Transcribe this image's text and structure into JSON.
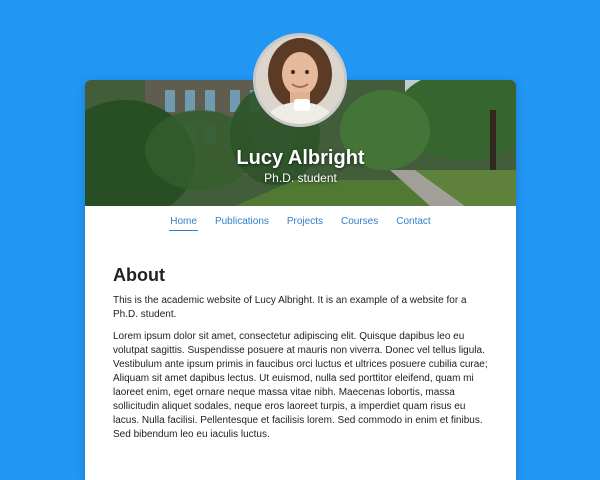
{
  "profile": {
    "name": "Lucy Albright",
    "subtitle": "Ph.D. student"
  },
  "nav": {
    "items": [
      {
        "label": "Home"
      },
      {
        "label": "Publications"
      },
      {
        "label": "Projects"
      },
      {
        "label": "Courses"
      },
      {
        "label": "Contact"
      }
    ],
    "active_index": 0
  },
  "about": {
    "heading": "About",
    "paragraphs": [
      "This is the academic website of Lucy Albright. It is an example of a website for a Ph.D. student.",
      "Lorem ipsum dolor sit amet, consectetur adipiscing elit. Quisque dapibus leo eu volutpat sagittis. Suspendisse posuere at mauris non viverra. Donec vel tellus ligula. Vestibulum ante ipsum primis in faucibus orci luctus et ultrices posuere cubilia curae; Aliquam sit amet dapibus lectus. Ut euismod, nulla sed porttitor eleifend, quam mi laoreet enim, eget ornare neque massa vitae nibh. Maecenas lobortis, massa sollicitudin aliquet sodales, neque eros laoreet turpis, a imperdiet quam risus eu lacus. Nulla facilisi. Pellentesque et facilisis lorem. Sed commodo in enim et finibus. Sed bibendum leo eu iaculis luctus."
    ]
  },
  "colors": {
    "background": "#2196f3",
    "link": "#2f7fc8"
  }
}
